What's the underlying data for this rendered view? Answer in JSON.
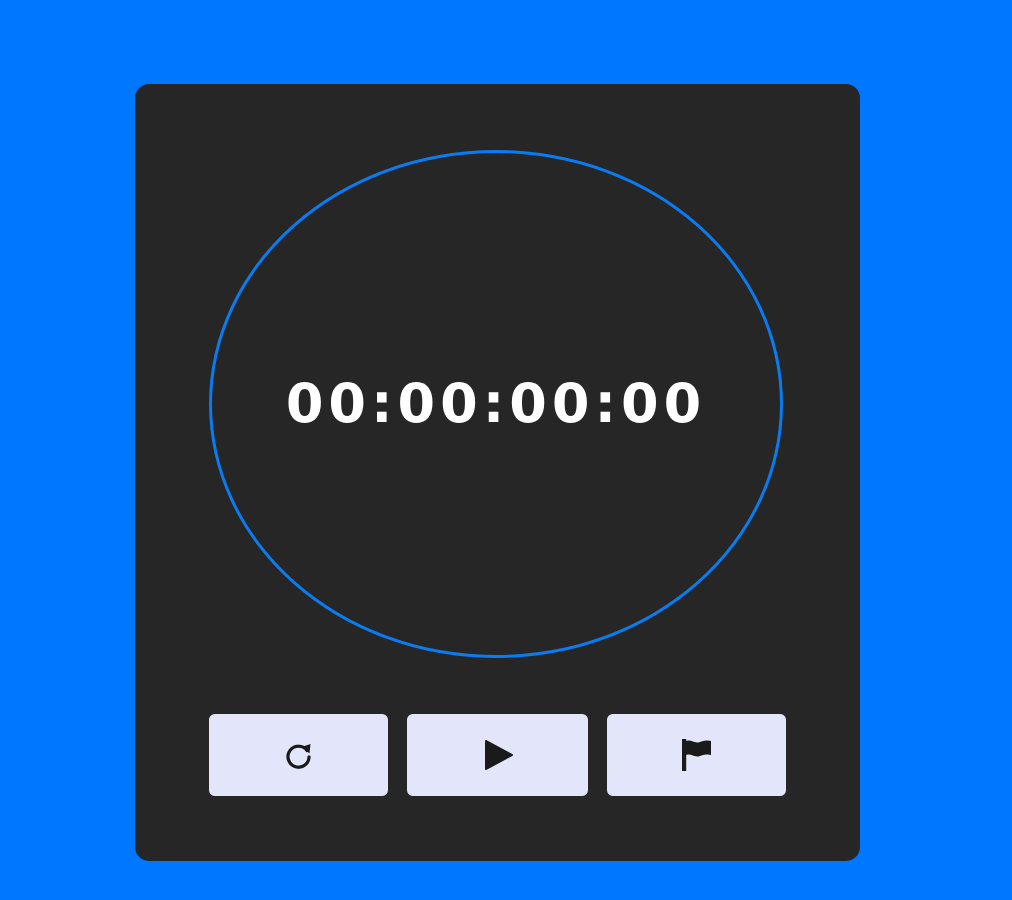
{
  "stopwatch": {
    "time": "00:00:00:00",
    "ring_color": "#0a7cf2",
    "card_color": "#262626",
    "background_color": "#0077ff"
  },
  "controls": [
    {
      "action": "reset",
      "icon": "redo-icon"
    },
    {
      "action": "start",
      "icon": "play-icon"
    },
    {
      "action": "lap",
      "icon": "flag-icon"
    }
  ]
}
